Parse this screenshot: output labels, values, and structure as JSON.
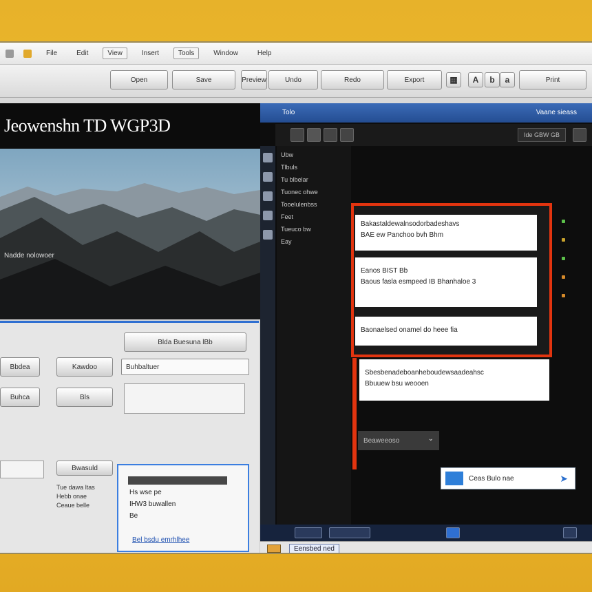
{
  "menubar": {
    "items": [
      "File",
      "Edit",
      "View",
      "Insert",
      "Tools",
      "Window",
      "Help"
    ]
  },
  "toolbar": {
    "buttons": [
      "Open",
      "Save",
      "Preview",
      "Undo",
      "Redo",
      "Export",
      "Print"
    ],
    "icon_labels": [
      "A",
      "b",
      "a"
    ]
  },
  "left": {
    "header_title": "Jeowenshn TD WGP3D",
    "hero_caption": "Nadde nolowoer",
    "form": {
      "primary_button": "Blda Buesuna lBb",
      "row1": [
        "Bbdea",
        "Kawdoo",
        "Buhbaltuer"
      ],
      "row2": [
        "Buhca",
        "Bls"
      ],
      "lower_left": "Bwasuld",
      "mini_list": [
        "Tue dawa ltas",
        "Hebb onae",
        "Ceaue belle"
      ],
      "popup": {
        "line1": "Hs wse pe",
        "line2": "IHW3 buwallen",
        "line3": "Be",
        "link": "Bel bsdu emrhlhee"
      }
    }
  },
  "right": {
    "title_left": "Tolo",
    "title_right": "Vaane sieass",
    "search_label": "Ide GBW GB",
    "nav_items": [
      "Ubw",
      "Tlbuls",
      "Tu blbelar",
      "Tuonec ohwe",
      "Tooelulenbss",
      "Feet",
      "Tueuco bw",
      "Eay"
    ],
    "cards": [
      {
        "line1": "Bakastaldewalnsodorbadeshavs",
        "line2": "BAE ew  Panchoo bvh Bhm"
      },
      {
        "line1": "Eanos  BIST Bb",
        "line2": "Baous fasla esmpeed IB Bhanhaloe 3"
      },
      {
        "line1": "Baonaelsed onamel do heee  fia"
      },
      {
        "line1": "Sbesbenadeboanheboudewsaadeahsc",
        "line2": "Bbuuew bsu weooen"
      }
    ],
    "dropdown_label": "Beaweeoso",
    "send_label": "Ceas Bulo nae",
    "status_label": "Eensbed ned"
  },
  "colors": {
    "accent_red": "#e2340f",
    "accent_blue": "#2f6fd1",
    "frame_gold": "#e7b22a",
    "green_indicator": "#5cc14a"
  }
}
